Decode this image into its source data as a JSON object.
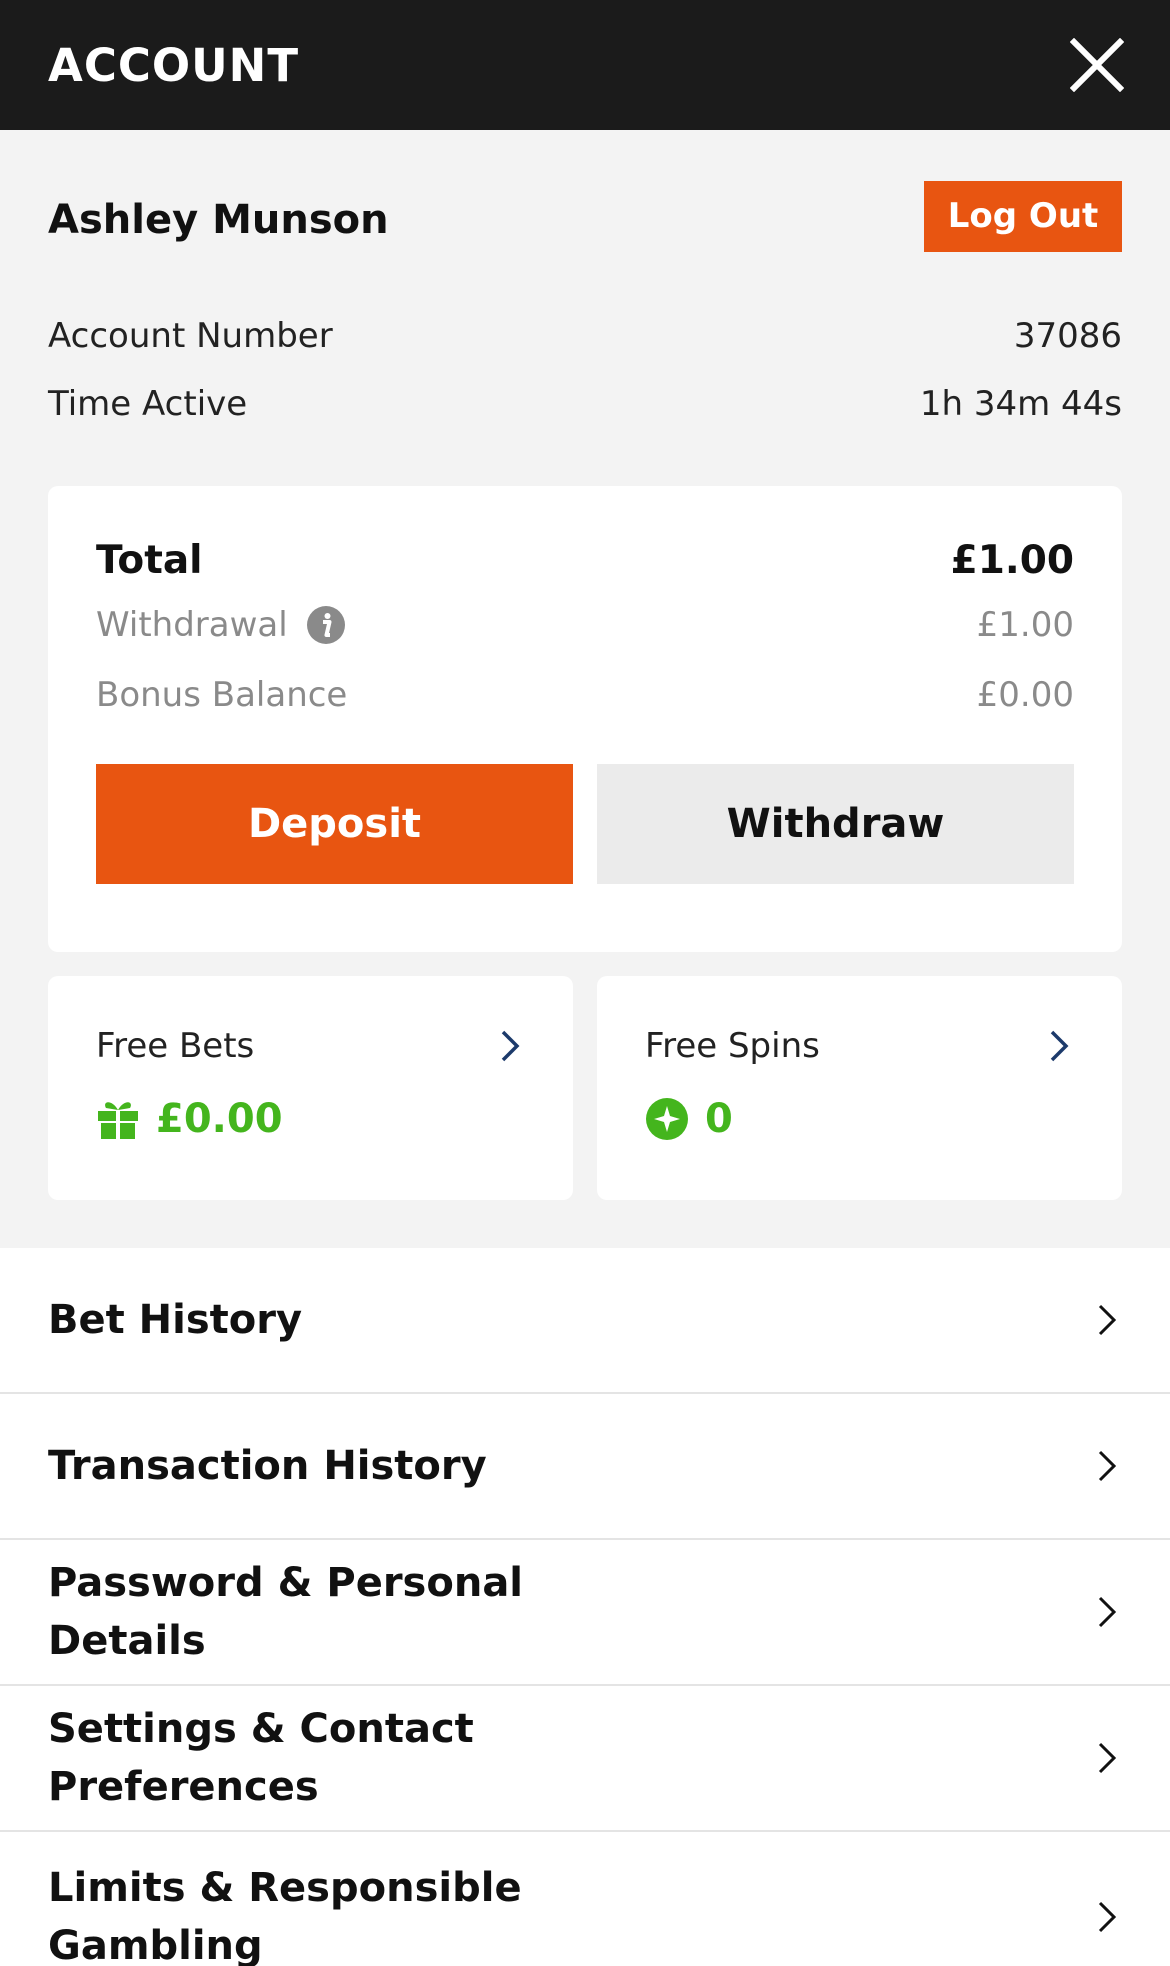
{
  "header": {
    "title": "ACCOUNT"
  },
  "account": {
    "name": "Ashley Munson",
    "logout_label": "Log Out",
    "number_label": "Account Number",
    "number_value": "37086",
    "time_label": "Time Active",
    "time_value": "1h 34m 44s"
  },
  "balance": {
    "total_label": "Total",
    "total_value": "£1.00",
    "withdrawal_label": "Withdrawal",
    "withdrawal_value": "£1.00",
    "bonus_label": "Bonus Balance",
    "bonus_value": "£0.00",
    "deposit_label": "Deposit",
    "withdraw_label": "Withdraw"
  },
  "promos": {
    "free_bets_label": "Free Bets",
    "free_bets_value": "£0.00",
    "free_spins_label": "Free Spins",
    "free_spins_value": "0"
  },
  "menu": {
    "items": [
      {
        "label": "Bet History"
      },
      {
        "label": "Transaction History"
      },
      {
        "label": "Password & Personal Details"
      },
      {
        "label": "Settings & Contact Preferences"
      },
      {
        "label": "Limits & Responsible Gambling"
      }
    ]
  },
  "icons": {
    "close": "close-icon",
    "info": "info-icon",
    "gift": "gift-icon",
    "spin": "plus-circle-icon",
    "chevron": "chevron-right-icon"
  },
  "colors": {
    "accent": "#e85511",
    "topbar": "#1b1b1b",
    "promo_green": "#44b51d",
    "background": "#f3f3f3"
  }
}
